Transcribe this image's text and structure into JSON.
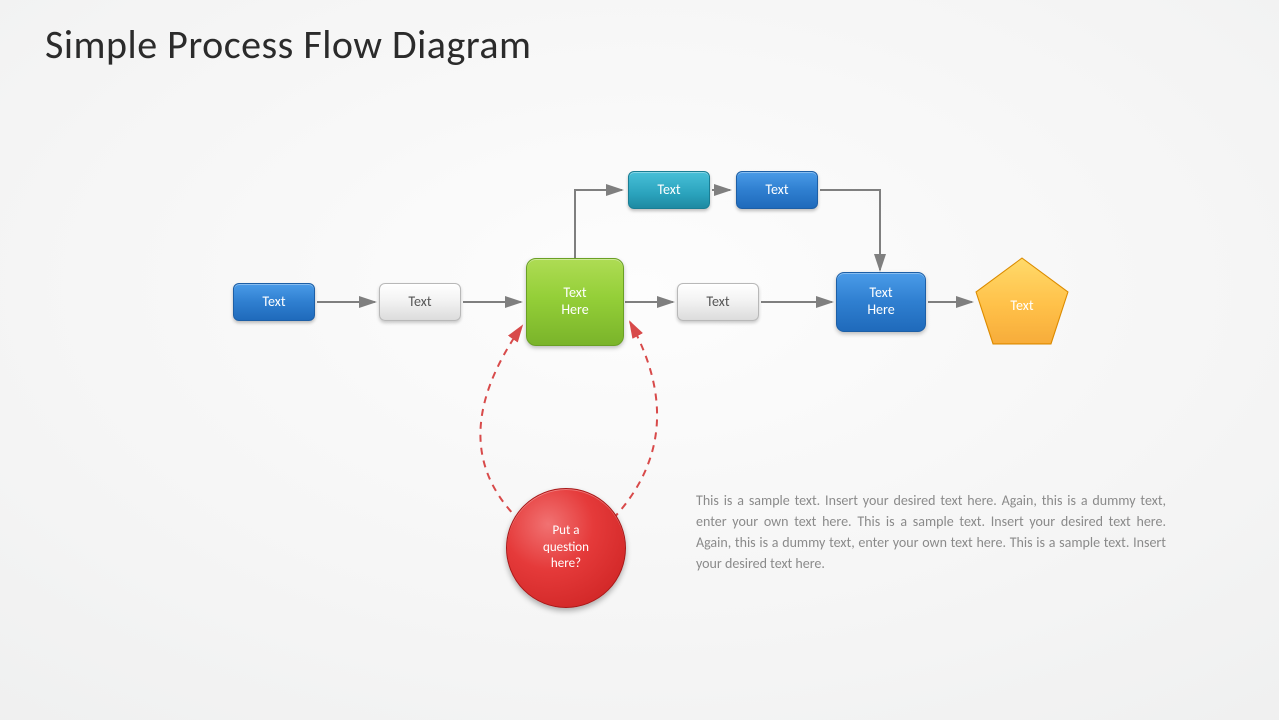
{
  "title": "Simple Process Flow Diagram",
  "nodes": {
    "start_blue": "Text",
    "grey1": "Text",
    "green_center": "Text\nHere",
    "grey2": "Text",
    "blue_tall": "Text\nHere",
    "teal_top": "Text",
    "blue_top": "Text",
    "pentagon": "Text",
    "circle": "Put a\nquestion\nhere?"
  },
  "description": "This is a sample text. Insert your desired text here. Again, this is a dummy text, enter your own text here. This is a sample text. Insert your desired text here. Again, this is a dummy text, enter your own text here. This is a sample text. Insert your desired text here.",
  "colors": {
    "arrow": "#7f7f7f",
    "dashed": "#d84a4a"
  }
}
